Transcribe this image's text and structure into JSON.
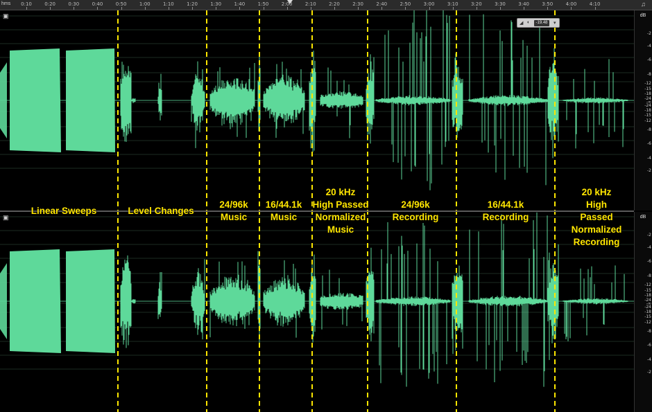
{
  "ruler": {
    "unit_label": "hms",
    "corner_icon": "waveform-icon",
    "ticks": [
      "0:10",
      "0:20",
      "0:30",
      "0:40",
      "0:50",
      "1:00",
      "1:10",
      "1:20",
      "1:30",
      "1:40",
      "1:50",
      "2:00",
      "2:10",
      "2:20",
      "2:30",
      "2:40",
      "2:50",
      "3:00",
      "3:10",
      "3:20",
      "3:30",
      "3:40",
      "3:50",
      "4:00",
      "4:10"
    ]
  },
  "db_scale": {
    "unit": "dB",
    "labels": [
      "-2",
      "-4",
      "-6",
      "-8",
      "-12",
      "-15",
      "-18",
      "-24",
      "-∞",
      "-24",
      "-18",
      "-15",
      "-12",
      "-8",
      "-6",
      "-4",
      "-2"
    ]
  },
  "zoom_control": {
    "value": "-19.48"
  },
  "segments": [
    {
      "label": "Linear Sweeps"
    },
    {
      "label": "Level Changes"
    },
    {
      "label": "24/96k\nMusic"
    },
    {
      "label": "16/44.1k\nMusic"
    },
    {
      "label": "20 kHz\nHigh Passed\nNormalized\nMusic"
    },
    {
      "label": "24/96k\nRecording"
    },
    {
      "label": "16/44.1k\nRecording"
    },
    {
      "label": "20 kHz\nHigh Passed\nNormalized\nRecording"
    }
  ],
  "colors": {
    "waveform": "#5ed99a",
    "divider": "#ffe600",
    "label": "#ffe600",
    "background": "#000000",
    "grid": "#1d2b22"
  }
}
